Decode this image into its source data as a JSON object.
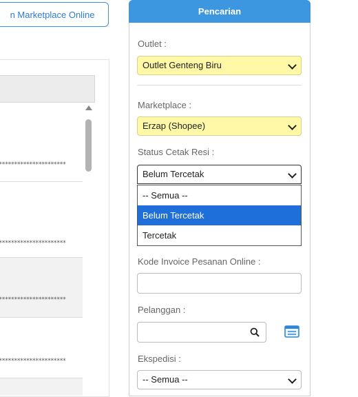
{
  "left": {
    "top_button_label": "n Marketplace Online",
    "row_stars": "**********************",
    "rows": [
      {
        "shade": false
      },
      {
        "shade": false
      },
      {
        "shade": true
      },
      {
        "shade": false
      },
      {
        "shade": true
      }
    ]
  },
  "search_panel": {
    "title": "Pencarian",
    "outlet": {
      "label": "Outlet :",
      "value": "Outlet Genteng Biru"
    },
    "marketplace": {
      "label": "Marketplace :",
      "value": "Erzap (Shopee)"
    },
    "status_cetak_resi": {
      "label": "Status Cetak Resi :",
      "value": "Belum Tercetak",
      "options": [
        "-- Semua --",
        "Belum Tercetak",
        "Tercetak"
      ],
      "selected_index": 1
    },
    "kode_invoice": {
      "label": "Kode Invoice Pesanan Online :",
      "value": ""
    },
    "pelanggan": {
      "label": "Pelanggan :",
      "value": ""
    },
    "ekspedisi": {
      "label": "Ekspedisi :",
      "value": "-- Semua --"
    }
  },
  "colors": {
    "accent": "#3d97e0",
    "highlight_select": "#fff8a6",
    "option_selected": "#1e6fd9"
  }
}
